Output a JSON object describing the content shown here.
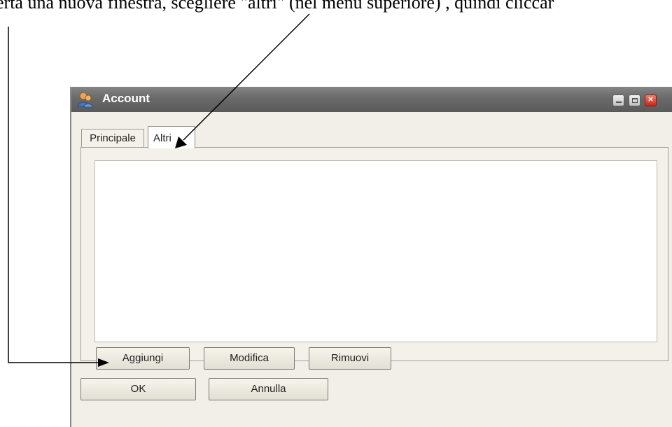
{
  "caption": "erta una nuova finestra, scegliere \"altri\" (nel menu superiore) , quindi cliccar",
  "window": {
    "title": "Account",
    "icon": "users-icon",
    "controls": [
      "minimize-icon",
      "maximize-icon",
      "close-icon"
    ]
  },
  "tabs": [
    {
      "label": "Principale",
      "active": false
    },
    {
      "label": "Altri",
      "active": true
    }
  ],
  "list": {
    "items": []
  },
  "list_buttons": {
    "add": "Aggiungi",
    "edit": "Modifica",
    "remove": "Rimuovi"
  },
  "dialog_buttons": {
    "ok": "OK",
    "cancel": "Annulla"
  },
  "colors": {
    "titlebar": "#6a6a6a",
    "window_bg": "#f1efe7",
    "close_button": "#d9342a"
  }
}
